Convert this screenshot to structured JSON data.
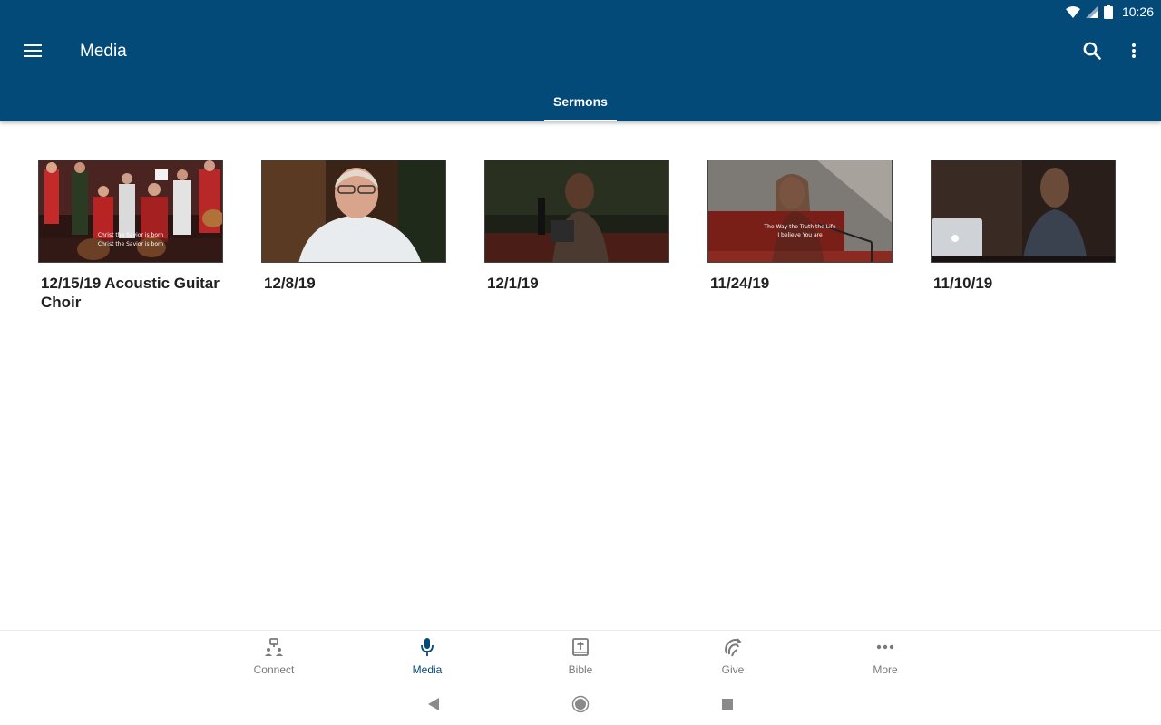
{
  "status_bar": {
    "time": "10:26"
  },
  "header": {
    "title": "Media"
  },
  "tabs": [
    {
      "label": "Sermons",
      "active": true
    }
  ],
  "media_items": [
    {
      "title": "12/15/19 Acoustic Guitar Choir",
      "caption_line1": "Christ the Savior is born",
      "caption_line2": "Christ the Savior is born"
    },
    {
      "title": "12/8/19"
    },
    {
      "title": "12/1/19"
    },
    {
      "title": "11/24/19",
      "caption_line1": "The Way the Truth the Life",
      "caption_line2": "I believe You are"
    },
    {
      "title": "11/10/19"
    }
  ],
  "bottom_nav": {
    "items": [
      {
        "label": "Connect",
        "icon": "connect-icon",
        "active": false
      },
      {
        "label": "Media",
        "icon": "microphone-icon",
        "active": true
      },
      {
        "label": "Bible",
        "icon": "bible-icon",
        "active": false
      },
      {
        "label": "Give",
        "icon": "give-icon",
        "active": false
      },
      {
        "label": "More",
        "icon": "more-horiz-icon",
        "active": false
      }
    ]
  },
  "colors": {
    "primary": "#044a79",
    "active_nav": "#044a79",
    "inactive_nav": "#7a7a7a"
  }
}
